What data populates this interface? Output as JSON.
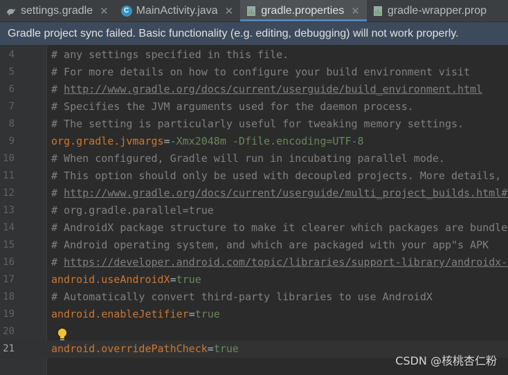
{
  "tabs": [
    {
      "label": "settings.gradle",
      "icon": "gradle-icon",
      "active": false
    },
    {
      "label": "MainActivity.java",
      "icon": "java-class-icon",
      "active": false
    },
    {
      "label": "gradle.properties",
      "icon": "properties-file-icon",
      "active": true
    },
    {
      "label": "gradle-wrapper.prop",
      "icon": "properties-file-icon",
      "active": false
    }
  ],
  "banner": {
    "text": "Gradle project sync failed. Basic functionality (e.g. editing, debugging) will not work properly."
  },
  "lines": [
    {
      "n": "4",
      "kind": "comment",
      "text": "# any settings specified in this file."
    },
    {
      "n": "5",
      "kind": "comment",
      "text": "# For more details on how to configure your build environment visit"
    },
    {
      "n": "6",
      "kind": "link",
      "prefix": "# ",
      "text": "http://www.gradle.org/docs/current/userguide/build_environment.html"
    },
    {
      "n": "7",
      "kind": "comment",
      "text": "# Specifies the JVM arguments used for the daemon process."
    },
    {
      "n": "8",
      "kind": "comment",
      "text": "# The setting is particularly useful for tweaking memory settings."
    },
    {
      "n": "9",
      "kind": "prop",
      "key": "org.gradle.jvmargs",
      "value": "-Xmx2048m -Dfile.encoding=UTF-8"
    },
    {
      "n": "10",
      "kind": "comment",
      "text": "# When configured, Gradle will run in incubating parallel mode."
    },
    {
      "n": "11",
      "kind": "comment",
      "text": "# This option should only be used with decoupled projects. More details, v"
    },
    {
      "n": "12",
      "kind": "link",
      "prefix": "# ",
      "text": "http://www.gradle.org/docs/current/userguide/multi_project_builds.html#s"
    },
    {
      "n": "13",
      "kind": "comment",
      "text": "# org.gradle.parallel=true"
    },
    {
      "n": "14",
      "kind": "comment",
      "text": "# AndroidX package structure to make it clearer which packages are bundled"
    },
    {
      "n": "15",
      "kind": "comment",
      "text": "# Android operating system, and which are packaged with your app\"s APK"
    },
    {
      "n": "16",
      "kind": "link",
      "prefix": "# ",
      "text": "https://developer.android.com/topic/libraries/support-library/androidx-r"
    },
    {
      "n": "17",
      "kind": "prop",
      "key": "android.useAndroidX",
      "value": "true"
    },
    {
      "n": "18",
      "kind": "comment",
      "text": "# Automatically convert third-party libraries to use AndroidX"
    },
    {
      "n": "19",
      "kind": "prop",
      "key": "android.enableJetifier",
      "value": "true"
    },
    {
      "n": "20",
      "kind": "empty",
      "text": ""
    },
    {
      "n": "21",
      "kind": "prop",
      "key": "android.overridePathCheck",
      "value": "true",
      "current": true
    }
  ],
  "watermark": "CSDN @核桃杏仁粉",
  "colors": {
    "comment": "#808080",
    "key": "#cc7832",
    "value": "#6a8759",
    "background": "#2b2b2b",
    "banner": "#3d4a5c"
  }
}
